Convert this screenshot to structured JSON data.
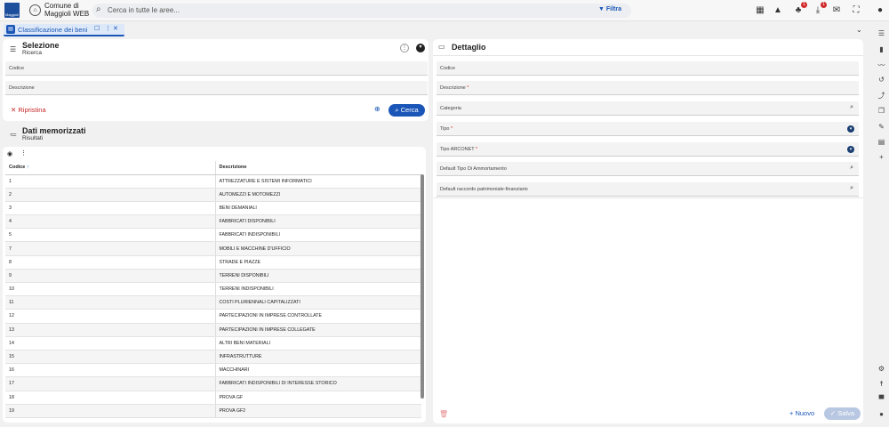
{
  "header": {
    "logo_text": "Maggioli",
    "app_name_line1": "Comune di",
    "app_name_line2": "Maggioli WEB",
    "search_placeholder": "Cerca in tutte le aree...",
    "filter_label": "Filtra",
    "notification_badge_1": "1",
    "notification_badge_2": "1"
  },
  "tabs": [
    {
      "label": "Classificazione dei beni"
    }
  ],
  "selezione": {
    "title": "Selezione",
    "subtitle": "Ricerca",
    "fields": [
      {
        "label": "Codice",
        "value": ""
      },
      {
        "label": "Descrizione",
        "value": ""
      }
    ],
    "reset_label": "Ripristina",
    "search_label": "Cerca"
  },
  "risultati": {
    "title": "Dati memorizzati",
    "subtitle": "Risultati",
    "columns": [
      "Codice",
      "Descrizione"
    ],
    "sort_indicator": "↑",
    "rows": [
      {
        "codice": "1",
        "descrizione": "ATTREZZATURE E SISTEMI INFORMATICI"
      },
      {
        "codice": "2",
        "descrizione": "AUTOMEZZI E MOTOMEZZI"
      },
      {
        "codice": "3",
        "descrizione": "BENI DEMANIALI"
      },
      {
        "codice": "4",
        "descrizione": "FABBRICATI DISPONIBILI"
      },
      {
        "codice": "5",
        "descrizione": "FABBRICATI INDISPONIBILI"
      },
      {
        "codice": "7",
        "descrizione": "MOBILI E MACCHINE D'UFFICIO"
      },
      {
        "codice": "8",
        "descrizione": "STRADE E PIAZZE"
      },
      {
        "codice": "9",
        "descrizione": "TERRENI DISPONIBILI"
      },
      {
        "codice": "10",
        "descrizione": "TERRENI INDISPONIBILI"
      },
      {
        "codice": "11",
        "descrizione": "COSTI PLURIENNALI CAPITALIZZATI"
      },
      {
        "codice": "12",
        "descrizione": "PARTECIPAZIONI IN IMPRESE CONTROLLATE"
      },
      {
        "codice": "13",
        "descrizione": "PARTECIPAZIONI IN IMPRESE COLLEGATE"
      },
      {
        "codice": "14",
        "descrizione": "ALTRI BENI MATERIALI"
      },
      {
        "codice": "15",
        "descrizione": "INFRASTRUTTURE"
      },
      {
        "codice": "16",
        "descrizione": "MACCHINARI"
      },
      {
        "codice": "17",
        "descrizione": "FABBRICATI INDISPONIBILI DI INTERESSE STORICO"
      },
      {
        "codice": "18",
        "descrizione": "PROVA GF"
      },
      {
        "codice": "19",
        "descrizione": "PROVA GF2"
      }
    ]
  },
  "dettaglio": {
    "title": "Dettaglio",
    "fields": [
      {
        "label": "Codice",
        "required": false,
        "control": "text"
      },
      {
        "label": "Descrizione",
        "required": true,
        "control": "text"
      },
      {
        "label": "Categoria",
        "required": false,
        "control": "search"
      },
      {
        "label": "Tipo",
        "required": true,
        "control": "dropdown"
      },
      {
        "label": "Tipo ARCONET",
        "required": true,
        "control": "dropdown"
      },
      {
        "label": "Default Tipo Di Ammortamento",
        "required": false,
        "control": "search"
      },
      {
        "label": "Default raccordo patrimoniale-finanziario",
        "required": false,
        "control": "search"
      }
    ],
    "new_label": "Nuovo",
    "save_label": "Salva"
  },
  "colors": {
    "accent": "#1a56b8",
    "danger": "#c62828",
    "tab_bg": "#dde9f8"
  }
}
